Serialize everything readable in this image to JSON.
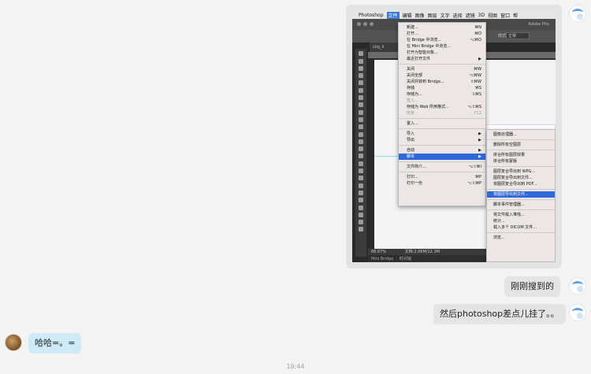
{
  "messages": {
    "m1_text": "刚刚搜到的",
    "m2_text": "然后photoshop差点儿挂了。。",
    "m3_text": "哈哈=。=",
    "timestamp": "19:44"
  },
  "screenshot": {
    "menubar": {
      "apple": "",
      "items": [
        "Photoshop",
        "文件",
        "编辑",
        "图像",
        "图层",
        "文字",
        "选择",
        "滤镜",
        "3D",
        "视图",
        "窗口",
        "帮"
      ],
      "active_index": 1
    },
    "window_title": "Adobe Pho",
    "doc_tab": "cbg_li",
    "options_label": "样式:",
    "options_value": "正常",
    "status": {
      "zoom": "66.67%",
      "doc": "文档:2.06M/12.3M"
    },
    "bottom_tabs": [
      "Mini Bridge",
      "时间轴"
    ],
    "file_menu": [
      {
        "label": "新建...",
        "shortcut": "⌘N"
      },
      {
        "label": "打开...",
        "shortcut": "⌘O"
      },
      {
        "label": "在 Bridge 中浏览...",
        "shortcut": "⌥⌘O"
      },
      {
        "label": "在 Mini Bridge 中浏览...",
        "shortcut": ""
      },
      {
        "label": "打开为智能对象...",
        "shortcut": ""
      },
      {
        "label": "最近打开文件",
        "shortcut": "",
        "submenu": true
      },
      {
        "sep": true
      },
      {
        "label": "关闭",
        "shortcut": "⌘W"
      },
      {
        "label": "关闭全部",
        "shortcut": "⌥⌘W"
      },
      {
        "label": "关闭并转到 Bridge...",
        "shortcut": "⇧⌘W"
      },
      {
        "label": "存储",
        "shortcut": "⌘S"
      },
      {
        "label": "存储为...",
        "shortcut": "⇧⌘S"
      },
      {
        "label": "签入...",
        "shortcut": "",
        "disabled": true
      },
      {
        "label": "存储为 Web 所用格式...",
        "shortcut": "⌥⇧⌘S"
      },
      {
        "label": "恢复",
        "shortcut": "F12",
        "disabled": true
      },
      {
        "sep": true
      },
      {
        "label": "置入...",
        "shortcut": ""
      },
      {
        "sep": true
      },
      {
        "label": "导入",
        "shortcut": "",
        "submenu": true
      },
      {
        "label": "导出",
        "shortcut": "",
        "submenu": true
      },
      {
        "sep": true
      },
      {
        "label": "自动",
        "shortcut": "",
        "submenu": true
      },
      {
        "label": "脚本",
        "shortcut": "",
        "submenu": true,
        "selected": true
      },
      {
        "sep": true
      },
      {
        "label": "文件简介...",
        "shortcut": "⌥⇧⌘I"
      },
      {
        "sep": true
      },
      {
        "label": "打印...",
        "shortcut": "⌘P"
      },
      {
        "label": "打印一份",
        "shortcut": "⌥⇧⌘P"
      }
    ],
    "script_submenu": [
      {
        "label": "图像处理器...",
        "shortcut": ""
      },
      {
        "sep": true
      },
      {
        "label": "删除所有空图层",
        "shortcut": ""
      },
      {
        "sep": true
      },
      {
        "label": "拼合所有图层效果",
        "shortcut": ""
      },
      {
        "label": "拼合所有蒙版",
        "shortcut": ""
      },
      {
        "sep": true
      },
      {
        "label": "图层复合导出到 WPG...",
        "shortcut": ""
      },
      {
        "label": "图层复合导出到文件...",
        "shortcut": ""
      },
      {
        "label": "将图层复合导出到 PDF...",
        "shortcut": ""
      },
      {
        "sep": true
      },
      {
        "label": "将图层导出到文件...",
        "shortcut": "",
        "selected": true
      },
      {
        "sep": true
      },
      {
        "label": "脚本事件管理器...",
        "shortcut": ""
      },
      {
        "sep": true
      },
      {
        "label": "将文件载入堆栈...",
        "shortcut": ""
      },
      {
        "label": "统计...",
        "shortcut": ""
      },
      {
        "label": "载入多个 DICOM 文件...",
        "shortcut": ""
      },
      {
        "sep": true
      },
      {
        "label": "浏览...",
        "shortcut": ""
      }
    ]
  }
}
